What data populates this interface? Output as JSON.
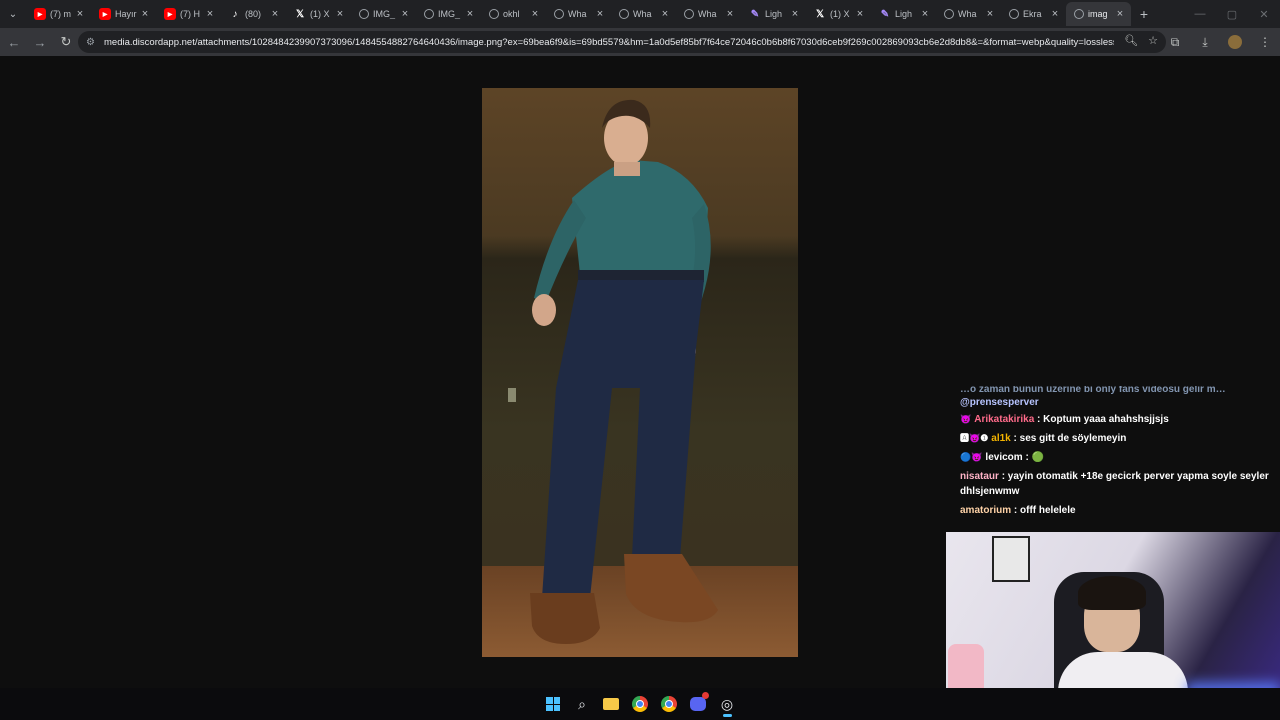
{
  "browser": {
    "tabs": [
      {
        "icon": "youtube-icon",
        "title": "(7) m",
        "active": false
      },
      {
        "icon": "youtube-icon",
        "title": "Hayır",
        "active": false
      },
      {
        "icon": "youtube-icon",
        "title": "(7) H",
        "active": false
      },
      {
        "icon": "tiktok-icon",
        "title": "(80)",
        "active": false
      },
      {
        "icon": "x-icon",
        "title": "(1) X",
        "active": false
      },
      {
        "icon": "globe-icon",
        "title": "IMG_",
        "active": false
      },
      {
        "icon": "globe-icon",
        "title": "IMG_",
        "active": false
      },
      {
        "icon": "globe-icon",
        "title": "okhl",
        "active": false
      },
      {
        "icon": "globe-icon",
        "title": "Wha",
        "active": false
      },
      {
        "icon": "globe-icon",
        "title": "Wha",
        "active": false
      },
      {
        "icon": "globe-icon",
        "title": "Wha",
        "active": false
      },
      {
        "icon": "pen-icon",
        "title": "Ligh",
        "active": false
      },
      {
        "icon": "x-icon",
        "title": "(1) X",
        "active": false
      },
      {
        "icon": "pen-icon",
        "title": "Ligh",
        "active": false
      },
      {
        "icon": "globe-icon",
        "title": "Wha",
        "active": false
      },
      {
        "icon": "globe-icon",
        "title": "Ekra",
        "active": false
      },
      {
        "icon": "globe-icon",
        "title": "imag",
        "active": true
      }
    ],
    "new_tab": "+",
    "close_glyph": "×",
    "url": "media.discordapp.net/attachments/1028484239907373096/1484554882764640436/image.png?ex=69bea6f9&is=69bd5579&hm=1a0d5ef85bf7f64ce72046c0b6b8f67030d6ceb9f269c002869093cb6e2d8db8&=&format=webp&quality=lossless..."
  },
  "chat": {
    "cut_line": "…o zaman bunun üzerine bi only fans videosu gelir m…",
    "mention": "@prensesperver",
    "messages": [
      {
        "badges": "😈",
        "name": "Arikatakirika",
        "color": "#ff6b8a",
        "text": ": Koptum yaaa ahahshsjjsjs"
      },
      {
        "badges": "🅰😈❶",
        "name": "al1k",
        "color": "#f4b400",
        "text": ": ses gitt de söylemeyin"
      },
      {
        "badges": "🔵😈",
        "name": "levicom",
        "color": "#ffffff",
        "text": ": 🟢"
      },
      {
        "badges": "",
        "name": "nisataur",
        "color": "#ffb3c7",
        "text": ": yayin otomatik +18e gecicrk perver yapma soyle seyler dhlsjenwmw"
      },
      {
        "badges": "",
        "name": "amatorium",
        "color": "#ffd3a8",
        "text": ": offf helelele"
      }
    ]
  },
  "taskbar": {
    "icons": [
      "windows-start-icon",
      "search-icon",
      "file-explorer-icon",
      "chrome-icon",
      "chrome-icon",
      "discord-icon",
      "obs-icon"
    ]
  }
}
